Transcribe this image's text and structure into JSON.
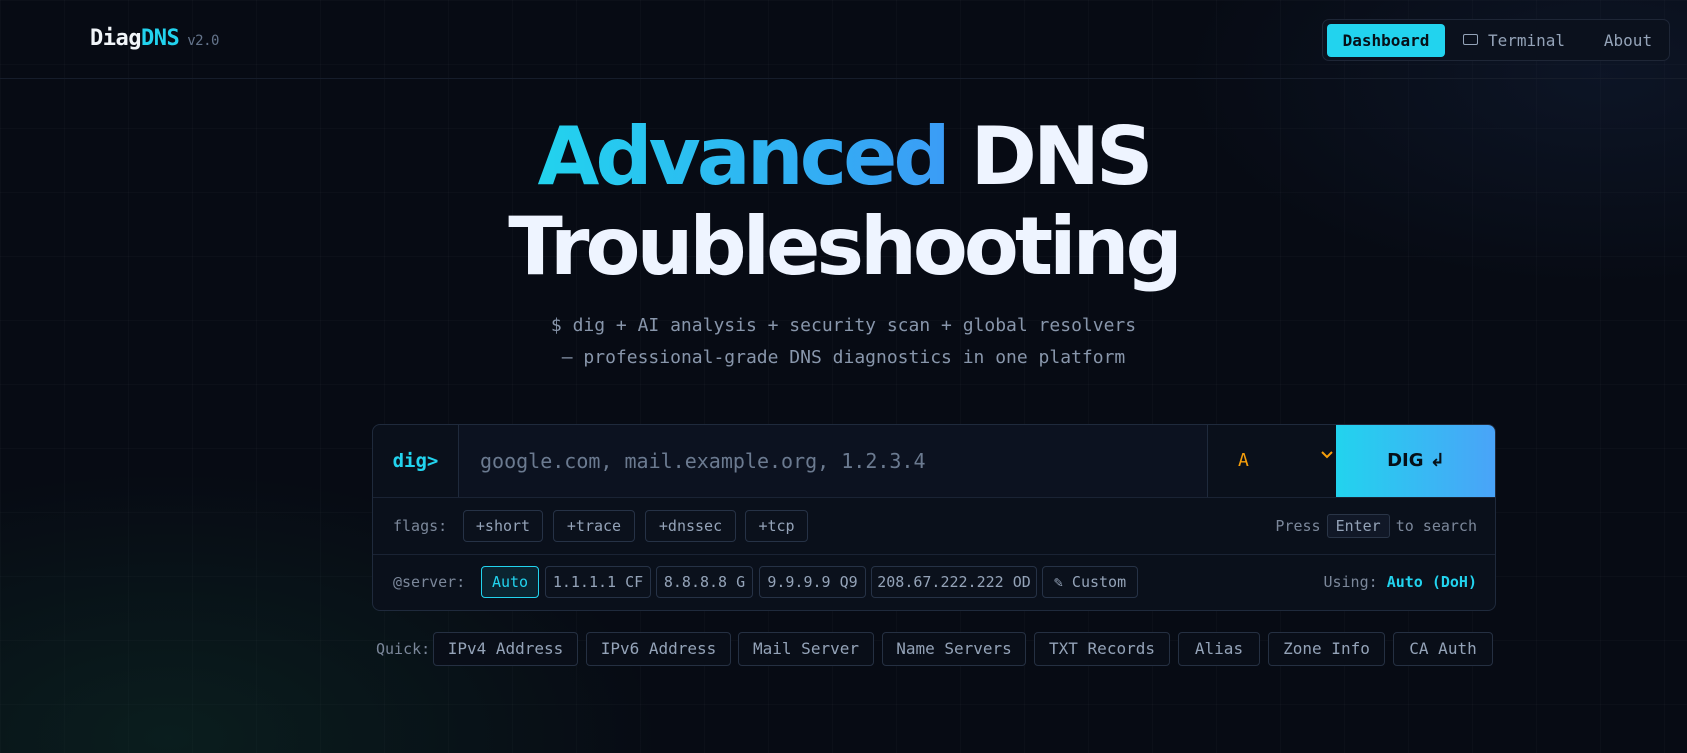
{
  "header": {
    "logo_part1": "Diag",
    "logo_part2": "DNS",
    "version": "v2.0",
    "nav": [
      {
        "label": "Dashboard",
        "active": true
      },
      {
        "label": "Terminal",
        "active": false
      },
      {
        "label": "About",
        "active": false
      }
    ]
  },
  "hero": {
    "title_highlight": "Advanced",
    "title_rest": "DNS",
    "title_line2": "Troubleshooting",
    "subtitle_line1": "$ dig + AI analysis + security scan + global resolvers",
    "subtitle_line2": "— professional-grade DNS diagnostics in one platform"
  },
  "search": {
    "prompt": "dig>",
    "placeholder": "google.com, mail.example.org, 1.2.3.4",
    "value": "",
    "record_type": "A",
    "button_label": "DIG ↲",
    "flags_label": "flags:",
    "flags": [
      "+short",
      "+trace",
      "+dnssec",
      "+tcp"
    ],
    "hint_prefix": "Press",
    "hint_key": "Enter",
    "hint_suffix": "to search",
    "server_label": "@server:",
    "servers": [
      {
        "label": "Auto",
        "selected": true
      },
      {
        "label": "1.1.1.1 CF",
        "selected": false
      },
      {
        "label": "8.8.8.8 G",
        "selected": false
      },
      {
        "label": "9.9.9.9 Q9",
        "selected": false
      },
      {
        "label": "208.67.222.222 OD",
        "selected": false
      },
      {
        "label": "✎ Custom",
        "selected": false
      }
    ],
    "using_label": "Using:",
    "using_value": "Auto (DoH)"
  },
  "quick": {
    "label": "Quick:",
    "items": [
      "IPv4 Address",
      "IPv6 Address",
      "Mail Server",
      "Name Servers",
      "TXT Records",
      "Alias",
      "Zone Info",
      "CA Auth"
    ]
  },
  "colors": {
    "accent": "#22d3ee",
    "accent_blue": "#3b9cf6",
    "record_type": "#f59e0b",
    "background": "#070b14"
  },
  "icons": {
    "terminal": "keyboard-icon",
    "dropdown": "chevron-down-icon",
    "custom": "pencil-icon"
  }
}
